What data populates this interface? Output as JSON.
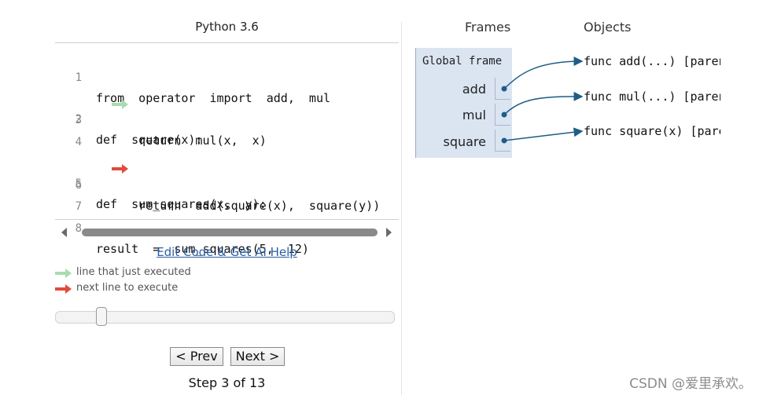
{
  "code_panel": {
    "language": "Python 3.6",
    "lines": [
      {
        "num": "1",
        "text": "from  operator  import  add,  mul"
      },
      {
        "num": "2",
        "text": "def  square(x):"
      },
      {
        "num": "3",
        "text": "      return  mul(x,  x)"
      },
      {
        "num": "4",
        "text": ""
      },
      {
        "num": "5",
        "text": "def  sum_squares(x,  y):"
      },
      {
        "num": "6",
        "text": "      return  add(square(x),  square(y))"
      },
      {
        "num": "7",
        "text": ""
      },
      {
        "num": "8",
        "text": "result  =  sum_squares(5,  12)"
      }
    ],
    "just_executed_line": 2,
    "next_line": 5,
    "edit_link": "Edit Code & Get AI Help",
    "legend": {
      "just_executed": "line that just executed",
      "next_to_execute": "next line to execute"
    },
    "prev_button": "< Prev",
    "next_button": "Next >",
    "step_text": "Step 3 of 13",
    "step_current": 3,
    "step_total": 13
  },
  "viz": {
    "frames_header": "Frames",
    "objects_header": "Objects",
    "global_frame": {
      "title": "Global frame",
      "vars": [
        "add",
        "mul",
        "square"
      ]
    },
    "objects": [
      "func add(...) [parent",
      "func mul(...) [parent",
      "func square(x) [parent"
    ]
  },
  "colors": {
    "green_arrow": "#a8dcb0",
    "red_arrow": "#e14b3b",
    "link": "#2b5fa5",
    "pointer": "#1f5d86",
    "frame_bg": "#dbe5f2"
  },
  "watermark": "CSDN @爱里承欢。"
}
